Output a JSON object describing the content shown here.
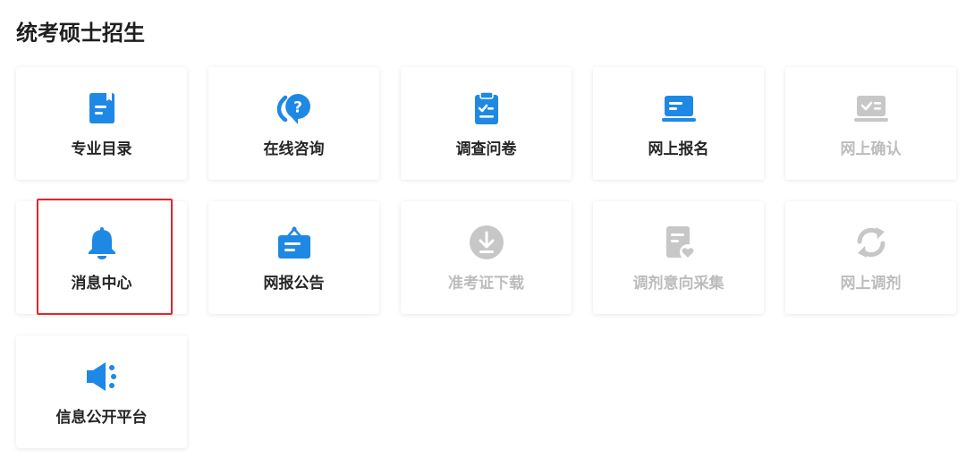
{
  "page_title": "统考硕士招生",
  "colors": {
    "active": "#1e88e5",
    "disabled": "#c7c7c7",
    "selected_outline": "#e8232a"
  },
  "cards": [
    {
      "label": "专业目录",
      "icon": "catalog-document-icon",
      "enabled": true
    },
    {
      "label": "在线咨询",
      "icon": "chat-question-icon",
      "enabled": true
    },
    {
      "label": "调查问卷",
      "icon": "clipboard-checklist-icon",
      "enabled": true
    },
    {
      "label": "网上报名",
      "icon": "laptop-icon",
      "enabled": true
    },
    {
      "label": "网上确认",
      "icon": "check-screen-icon",
      "enabled": false
    },
    {
      "label": "消息中心",
      "icon": "bell-icon",
      "enabled": true,
      "selected": true
    },
    {
      "label": "网报公告",
      "icon": "notice-bag-icon",
      "enabled": true
    },
    {
      "label": "准考证下载",
      "icon": "download-icon",
      "enabled": false
    },
    {
      "label": "调剂意向采集",
      "icon": "document-heart-icon",
      "enabled": false
    },
    {
      "label": "网上调剂",
      "icon": "refresh-icon",
      "enabled": false
    },
    {
      "label": "信息公开平台",
      "icon": "speaker-icon",
      "enabled": true
    }
  ]
}
